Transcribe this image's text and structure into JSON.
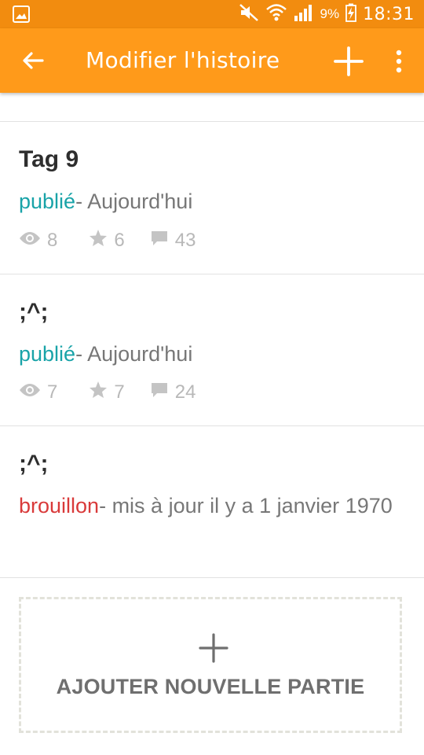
{
  "status_bar": {
    "battery_percent": "9%",
    "time": "18:31",
    "icons": [
      "gallery-icon",
      "mute-icon",
      "wifi-icon",
      "signal-icon",
      "battery-charging-icon"
    ]
  },
  "app_bar": {
    "title": "Modifier l'histoire",
    "icons": [
      "back-arrow-icon",
      "add-icon",
      "more-vert-icon"
    ]
  },
  "parts": [
    {
      "title": "Tag 9",
      "status": "publié",
      "status_suffix": "- Aujourd'hui",
      "views": "8",
      "votes": "6",
      "comments": "43"
    },
    {
      "title": ";^;",
      "status": "publié",
      "status_suffix": "- Aujourd'hui",
      "views": "7",
      "votes": "7",
      "comments": "24"
    },
    {
      "title": ";^;",
      "status": "brouillon",
      "status_suffix": "- mis à jour il y a 1 janvier 1970"
    }
  ],
  "add_part": {
    "label": "AJOUTER NOUVELLE PARTIE"
  },
  "colors": {
    "status_bar": "#F28C0F",
    "app_bar": "#FF9A1A",
    "published": "#19A3A8",
    "draft": "#D93A3A"
  }
}
